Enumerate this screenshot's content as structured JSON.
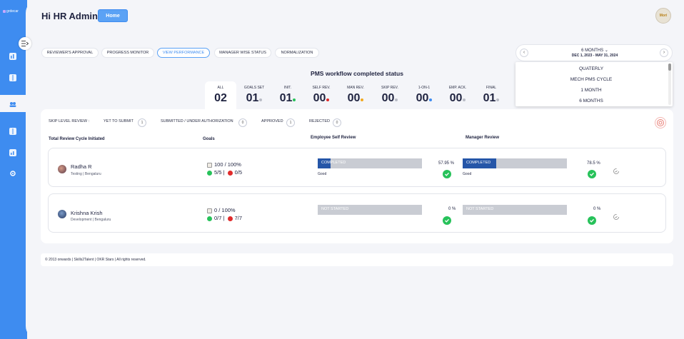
{
  "brand": {
    "logo_text": "grdecar"
  },
  "header": {
    "greeting": "Hi HR Admin",
    "home_label": "Home",
    "avatar_text": "Mori"
  },
  "tabs": [
    {
      "label": "REVIEWER'S APPROVAL"
    },
    {
      "label": "PROGRESS MONITOR"
    },
    {
      "label": "VIEW PERFORMANCE",
      "active": true
    },
    {
      "label": "MANAGER WISE STATUS"
    },
    {
      "label": "NORMALIZATION"
    }
  ],
  "date_selector": {
    "period": "6 MONTHS",
    "range": "DEC 1, 2023 - MAY 31, 2024",
    "prev": "‹",
    "next": "›",
    "options": [
      "QUATERLY",
      "MECH PMS CYCLE",
      "1 MONTH",
      "6 MONTHS"
    ]
  },
  "pms": {
    "title": "PMS workflow completed status",
    "stages": [
      {
        "label": "ALL",
        "value": "02",
        "dot": ""
      },
      {
        "label": "GOALS SET",
        "value": "01",
        "dot": "#b9bcc6"
      },
      {
        "label": "INIT.",
        "value": "01",
        "dot": "#27c25a"
      },
      {
        "label": "SELF REV.",
        "value": "00",
        "dot": "#e02b2b"
      },
      {
        "label": "MAN REV.",
        "value": "00",
        "dot": "#f2a81d"
      },
      {
        "label": "SKIP REV.",
        "value": "00",
        "dot": "#b9bcc6"
      },
      {
        "label": "1-ON-1",
        "value": "00",
        "dot": "#3e8cf0"
      },
      {
        "label": "EMP. ACK.",
        "value": "00",
        "dot": "#b9bcc6"
      },
      {
        "label": "FINAL",
        "value": "01",
        "dot": "#b9bcc6"
      }
    ]
  },
  "skip_level": {
    "label": "SKIP LEVEL REVIEW :",
    "items": [
      {
        "label": "YET TO SUBMIT",
        "count": "1"
      },
      {
        "label": "SUBMITTED / UNDER AUTHORIZATION",
        "count": "0"
      },
      {
        "label": "APPROVED",
        "count": "1"
      },
      {
        "label": "REJECTED",
        "count": "0"
      }
    ]
  },
  "columns": {
    "cycle": "Total Review Cycle Initiated",
    "goals": "Goals",
    "self_review": "Employee Self Review",
    "manager_review": "Manager Review"
  },
  "employees": [
    {
      "name": "Radha R",
      "meta": "Testing | Bengaluru",
      "goal_pct": "100 / 100%",
      "goals_done": "5/5",
      "sep": "|",
      "goals_rejected": "0/5",
      "self_status": "COMPLETED",
      "self_fill": 0.12,
      "self_note": "Good",
      "self_pct": "57.95 %",
      "mgr_status": "COMPLETED",
      "mgr_fill": 0.32,
      "mgr_note": "Good",
      "mgr_pct": "78.5 %"
    },
    {
      "name": "Krishna Krish",
      "meta": "Development | Bengaluru",
      "goal_pct": "0 / 100%",
      "goals_done": "0/7",
      "sep": "|",
      "goals_rejected": "7/7",
      "self_status": "NOT STARTED",
      "self_fill": 0,
      "self_note": "",
      "self_pct": "0 %",
      "mgr_status": "NOT STARTED",
      "mgr_fill": 0,
      "mgr_note": "",
      "mgr_pct": "0 %"
    }
  ],
  "footer": {
    "text": "© 2013 onwards | Skills2Talent | OKR Stars | All rights reserved."
  },
  "colors": {
    "accent": "#3e8cf0",
    "bar_fill": "#2556a8",
    "bar_bg": "#c9ccd3",
    "success": "#27c25a",
    "danger": "#e02b2b"
  }
}
